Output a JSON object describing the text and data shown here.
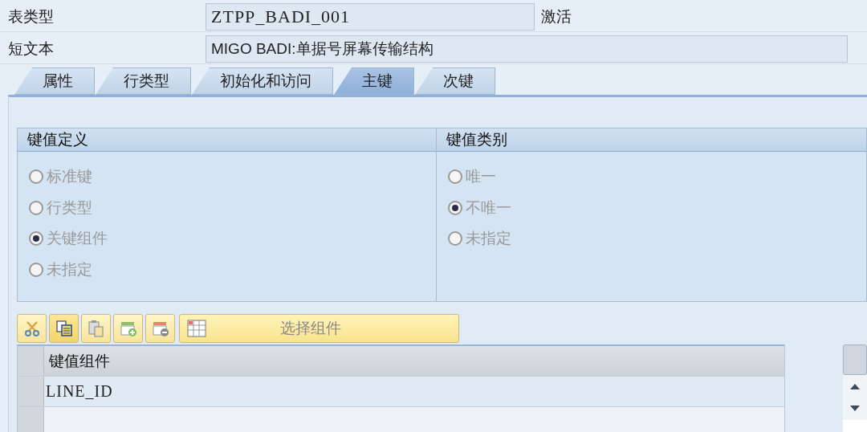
{
  "header_fields": [
    {
      "label": "表类型",
      "value": "ZTPP_BADI_001",
      "status": "激活"
    },
    {
      "label": "短文本",
      "value": "MIGO BADI:单据号屏幕传输结构"
    }
  ],
  "tabs": [
    {
      "label": "属性",
      "selected": false
    },
    {
      "label": "行类型",
      "selected": false
    },
    {
      "label": "初始化和访问",
      "selected": false
    },
    {
      "label": "主键",
      "selected": true
    },
    {
      "label": "次键",
      "selected": false
    }
  ],
  "groups": [
    {
      "title": "键值定义",
      "options": [
        {
          "label": "标准键",
          "selected": false,
          "disabled": true
        },
        {
          "label": "行类型",
          "selected": false,
          "disabled": true
        },
        {
          "label": "关键组件",
          "selected": true,
          "disabled": true
        },
        {
          "label": "未指定",
          "selected": false,
          "disabled": true
        }
      ]
    },
    {
      "title": "键值类别",
      "options": [
        {
          "label": "唯一",
          "selected": false,
          "disabled": true
        },
        {
          "label": "不唯一",
          "selected": true,
          "disabled": true
        },
        {
          "label": "未指定",
          "selected": false,
          "disabled": true
        }
      ]
    }
  ],
  "toolbar": {
    "tools": [
      {
        "kind": "cut"
      },
      {
        "kind": "copy"
      },
      {
        "kind": "paste"
      },
      {
        "kind": "insert"
      },
      {
        "kind": "delete"
      }
    ],
    "select_button": {
      "label": "选择组件",
      "disabled": true
    }
  },
  "table": {
    "columns": [
      "键值组件"
    ],
    "rows": [
      [
        "LINE_ID"
      ]
    ]
  }
}
